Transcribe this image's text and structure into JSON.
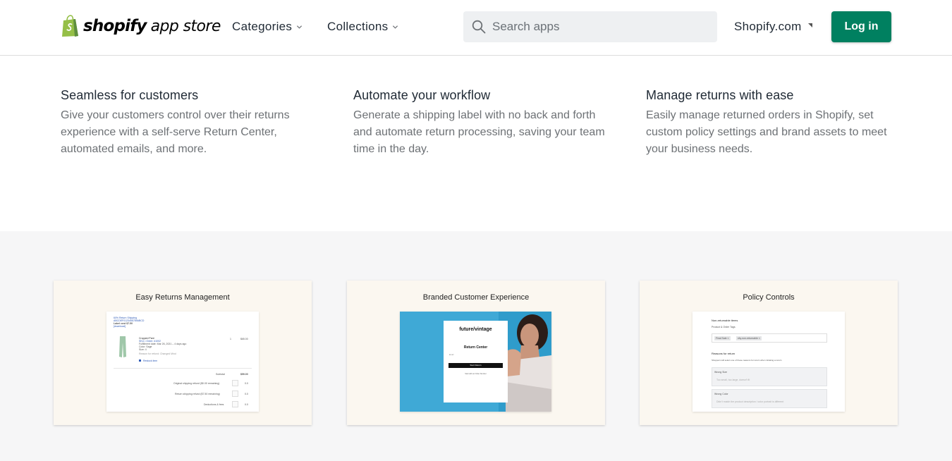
{
  "header": {
    "logo_brand": "shopify",
    "logo_suffix": "app store",
    "nav": [
      {
        "label": "Categories"
      },
      {
        "label": "Collections"
      }
    ],
    "search_placeholder": "Search apps",
    "shopify_link": "Shopify.com",
    "login_label": "Log in",
    "colors": {
      "brand_green": "#008060",
      "logo_green": "#95bf47"
    }
  },
  "features": [
    {
      "title": "Seamless for customers",
      "text": "Give your customers control over their returns experience with a self-serve Return Center, automated emails, and more."
    },
    {
      "title": "Automate your workflow",
      "text": "Generate a shipping label with no back and forth and automate return processing, saving your team time in the day."
    },
    {
      "title": "Manage returns with ease",
      "text": "Easily manage returned orders in Shopify, set custom policy settings and brand assets to meet your business needs."
    }
  ],
  "screenshots": [
    {
      "title": "Easy Returns Management",
      "mock": {
        "header_lines": [
          "60% Return Shipping",
          "ABCDEF0123456789ABCD",
          "Label cost $7.50",
          "[download]"
        ],
        "item_name": "Cropped Pant",
        "item_meta": [
          "SKU • Order: #1002",
          "Fulfillment date: Mar 26, 2021 – 4 days ago",
          "Color: Sage",
          "Size: 4",
          "Reason for refund: Changed Mind"
        ],
        "item_qty": "1",
        "item_price": "$65.00",
        "item_action": "Restock item",
        "summary": [
          {
            "label": "Subtotal",
            "value": "$59.00"
          },
          {
            "label": "Original shipping refund ($0.00 remaining)",
            "value": "0.0"
          },
          {
            "label": "Return shipping refund ($7.50 remaining)",
            "value": "0.0"
          },
          {
            "label": "Deductions & fees",
            "value": "0.0"
          }
        ]
      }
    },
    {
      "title": "Branded Customer Experience",
      "mock": {
        "brand": "future/vintage",
        "panel_title": "Return Center",
        "email_label": "Email",
        "button": "Start Return",
        "alt_link": "Start with an Order Number"
      }
    },
    {
      "title": "Policy Controls",
      "mock": {
        "section1": "Non-returnable items",
        "section1_sub": "Product & Order Tags",
        "tags": [
          "Final Sale ×",
          "nfq-non-returnable ×"
        ],
        "section2": "Reasons for return",
        "section2_sub": "Shoppers will select one of these reasons for return when initiating a return",
        "reasons": [
          {
            "label": "Wrong Size",
            "hint": "Too small, too large, doesn't fit"
          },
          {
            "label": "Wrong Color",
            "hint": "Didn't match the product description / color portrait is different"
          }
        ]
      }
    }
  ]
}
